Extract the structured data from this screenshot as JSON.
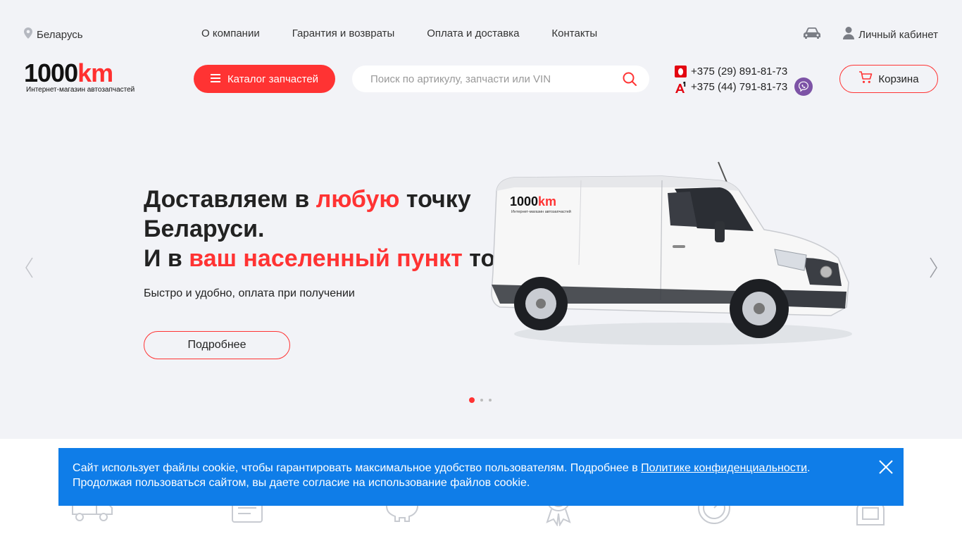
{
  "header": {
    "region": "Беларусь",
    "nav": [
      "О компании",
      "Гарантия и возвраты",
      "Оплата и доставка",
      "Контакты"
    ],
    "cabinet": "Личный кабинет",
    "logo": {
      "main": "1000",
      "accent": "km",
      "tagline": "Интернет-магазин автозапчастей"
    },
    "catalog_button": "Каталог запчастей",
    "search_placeholder": "Поиск по артикулу, запчасти или VIN",
    "phones": [
      {
        "operator": "MTS",
        "number": "+375 (29) 891-81-73"
      },
      {
        "operator": "A1",
        "number": "+375 (44) 791-81-73"
      }
    ],
    "cart": "Корзина"
  },
  "hero": {
    "title_part1": "Доставляем в ",
    "title_highlight1": "любую",
    "title_part2": " точку Беларуси.",
    "title_part3": "И в ",
    "title_highlight2": "ваш населенный пункт",
    "title_part4": " тоже!",
    "subtitle": "Быстро и удобно, оплата при получении",
    "button": "Подробнее",
    "van_logo_main": "1000",
    "van_logo_accent": "km",
    "van_logo_tagline": "Интернет-магазин автозапчастей",
    "slides_total": 3,
    "active_slide": 1
  },
  "features": [
    {
      "icon": "delivery-truck-icon"
    },
    {
      "icon": "catalog-icon"
    },
    {
      "icon": "piggy-bank-icon"
    },
    {
      "icon": "award-icon"
    },
    {
      "icon": "stopwatch-icon"
    },
    {
      "icon": "courier-icon"
    }
  ],
  "cookie": {
    "text_before": "Сайт использует файлы cookie, чтобы гарантировать максимальное удобство пользователям. Подробнее в ",
    "link": "Политике конфиденциальности",
    "text_after": ". Продолжая пользоваться сайтом, вы даете согласие на использование файлов cookie."
  },
  "colors": {
    "accent": "#ff3333",
    "cookie_bg": "#0f7de8",
    "page_bg": "#f2f3f7"
  }
}
